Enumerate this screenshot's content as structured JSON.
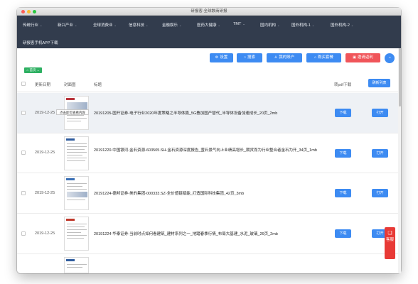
{
  "window": {
    "title": "研报客-全球数商研报"
  },
  "nav": {
    "items": [
      {
        "label": "传统行业",
        "caret": "⌄"
      },
      {
        "label": "新兴产业",
        "caret": "⌄"
      },
      {
        "label": "全球消费业",
        "caret": "⌄"
      },
      {
        "label": "信息科技",
        "caret": "⌄"
      },
      {
        "label": "金融娱乐",
        "caret": "⌄"
      },
      {
        "label": "医药大健康",
        "caret": "⌄"
      },
      {
        "label": "TMT",
        "caret": "⌄"
      },
      {
        "label": "国内机构",
        "caret": "⌄"
      },
      {
        "label": "国外机构-1",
        "caret": "⌄"
      },
      {
        "label": "国外机构-2",
        "caret": "⌄"
      }
    ],
    "app_download": "研报客手机APP下载"
  },
  "toolbar": {
    "settings": "设置",
    "search": "搜索",
    "account": "我的账户",
    "purchase": "购买套餐",
    "invite": "邀请返利",
    "colors": {
      "blue": "#3d8bf2",
      "red": "#f0555a"
    }
  },
  "breadcrumb": {
    "home": "首页"
  },
  "table": {
    "headers": {
      "date": "更新日期",
      "cover": "封面图",
      "title": "标题",
      "pdf": "转pdf下载",
      "refresh": "刷新列表"
    },
    "rows": [
      {
        "date": "2019-12-25",
        "title": "20191205-国开证券-电子行业2020年度策略之半导体篇_5G叠加国产替代_半导体设备加速成长_20页_2mb",
        "tooltip": "点击即可查看内容",
        "download": "下载",
        "open": "打开"
      },
      {
        "date": "2019-12-25",
        "title": "20191220-中国银河-金石资源-603505.SH-金石资源深度报告_萤石景气向上业绩高增长_期货而为行业整合者金石为开_34页_1mb",
        "download": "下载",
        "open": "打开"
      },
      {
        "date": "2019-12-25",
        "title": "20191224-德邦证券-美的集团-000333.SZ-全价值链赋能_打造国际科技集团_42页_3mb",
        "download": "下载",
        "open": "打开"
      },
      {
        "date": "2019-12-25",
        "title": "20191224-华泰证券-当前时点如何看建筑_建材系列之一_地踏春季行情_布局大基建_水泥_玻璃_26页_2mb",
        "download": "下载",
        "open": "打开"
      }
    ]
  },
  "service": {
    "label": "客服"
  }
}
